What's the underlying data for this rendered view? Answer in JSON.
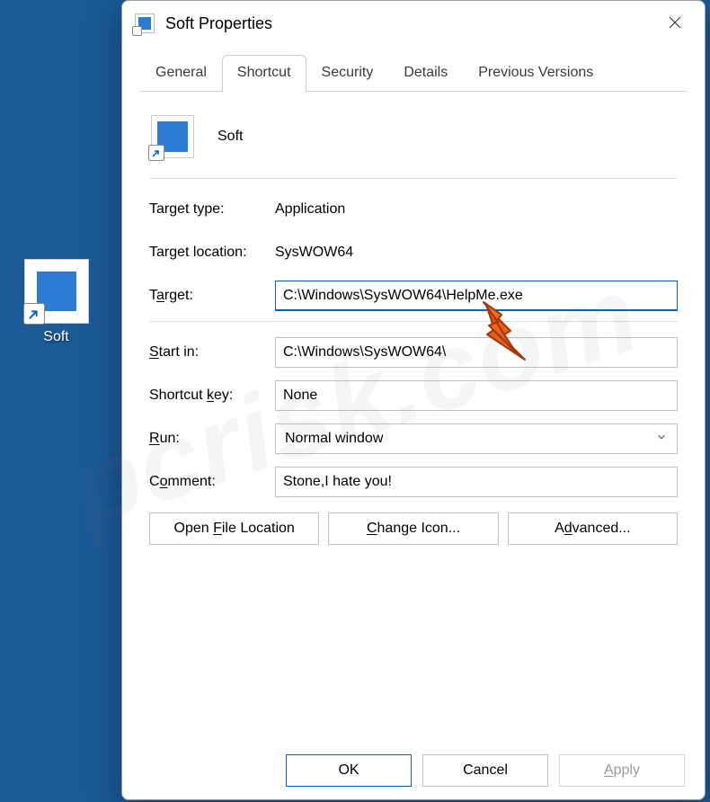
{
  "desktop": {
    "icon_label": "Soft"
  },
  "dialog": {
    "title": "Soft Properties",
    "tabs": [
      "General",
      "Shortcut",
      "Security",
      "Details",
      "Previous Versions"
    ],
    "active_tab": 1,
    "name": "Soft",
    "target_type_label": "Target type:",
    "target_type_value": "Application",
    "target_location_label": "Target location:",
    "target_location_value": "SysWOW64",
    "target_label_pre": "T",
    "target_label_u": "a",
    "target_label_post": "rget:",
    "target_value": "C:\\Windows\\SysWOW64\\HelpMe.exe",
    "startin_label_u": "S",
    "startin_label_post": "tart in:",
    "startin_value": "C:\\Windows\\SysWOW64\\",
    "shortcutkey_label_pre": "Shortcut ",
    "shortcutkey_label_u": "k",
    "shortcutkey_label_post": "ey:",
    "shortcutkey_value": "None",
    "run_label_u": "R",
    "run_label_post": "un:",
    "run_value": "Normal window",
    "comment_label_pre": "C",
    "comment_label_u": "o",
    "comment_label_post": "mment:",
    "comment_value": "Stone,I hate you!",
    "open_file_location_pre": "Open ",
    "open_file_location_u": "F",
    "open_file_location_post": "ile Location",
    "change_icon_u": "C",
    "change_icon_post": "hange Icon...",
    "advanced_pre": "A",
    "advanced_u": "d",
    "advanced_post": "vanced...",
    "ok": "OK",
    "cancel": "Cancel",
    "apply_u": "A",
    "apply_post": "pply"
  },
  "watermark": "pcrisk.com"
}
